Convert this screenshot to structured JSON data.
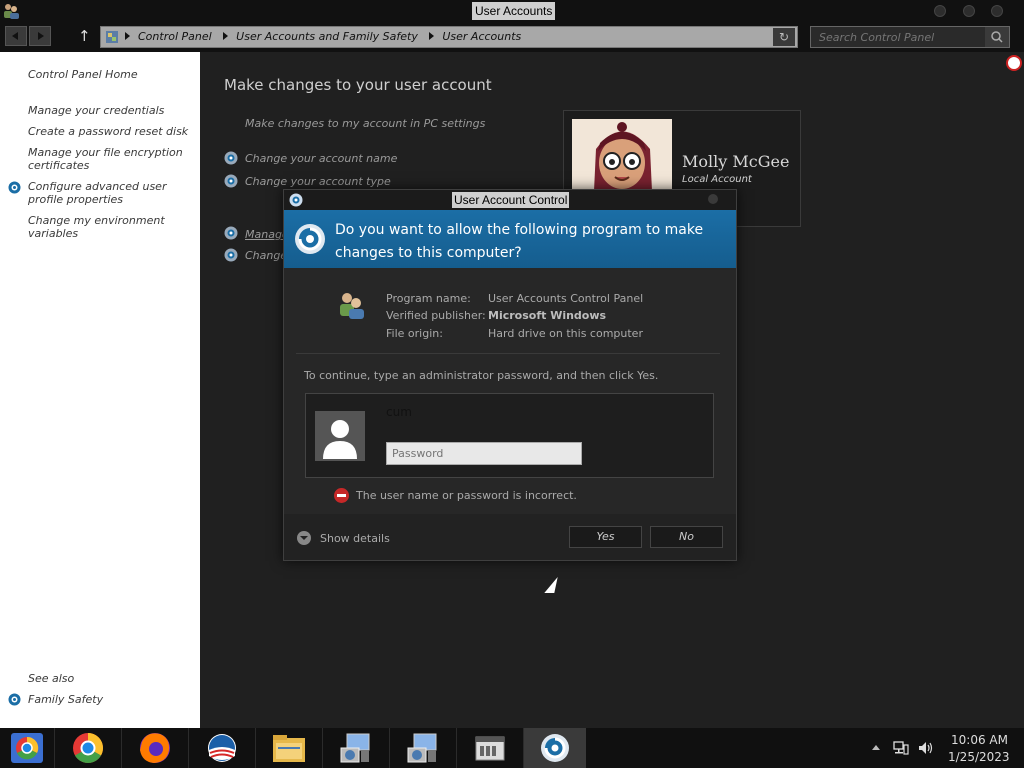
{
  "window": {
    "title": "User Accounts",
    "icon": "users-icon"
  },
  "address_bar": {
    "crumbs": [
      "Control Panel",
      "User Accounts and Family Safety",
      "User Accounts"
    ],
    "search_placeholder": "Search Control Panel"
  },
  "left_pane": {
    "home": "Control Panel Home",
    "links": [
      "Manage your credentials",
      "Create a password reset disk",
      "Manage your file encryption certificates",
      "Configure advanced user profile properties",
      "Change my environment variables"
    ],
    "see_also_label": "See also",
    "see_also_links": [
      "Family Safety"
    ]
  },
  "main": {
    "title": "Make changes to your user account",
    "pc_settings_link": "Make changes to my account in PC settings",
    "tasks": [
      "Change your account name",
      "Change your account type",
      "Manage",
      "Change"
    ],
    "user": {
      "name": "Molly McGee",
      "type": "Local Account"
    }
  },
  "uac": {
    "title": "User Account Control",
    "question": "Do you want to allow the following program to make changes to this computer?",
    "program_name_label": "Program name:",
    "program_name": "User Accounts Control Panel",
    "publisher_label": "Verified publisher:",
    "publisher": "Microsoft Windows",
    "origin_label": "File origin:",
    "origin": "Hard drive on this computer",
    "instruction": "To continue, type an administrator password, and then click Yes.",
    "admin_user": "cum",
    "password_placeholder": "Password",
    "error": "The user name or password is incorrect.",
    "show_details": "Show details",
    "yes": "Yes",
    "no": "No"
  },
  "taskbar": {
    "apps": [
      "chrome-canary-icon",
      "chrome-icon",
      "firefox-icon",
      "obama-logo-icon",
      "file-explorer-icon",
      "control-panel-icon",
      "control-panel-icon-2",
      "window-manager-icon",
      "uac-shield-icon"
    ],
    "time": "10:06 AM",
    "date": "1/25/2023"
  },
  "colors": {
    "uac_header": "#1b6ea6",
    "background": "#202020",
    "left_pane": "#ffffff"
  }
}
